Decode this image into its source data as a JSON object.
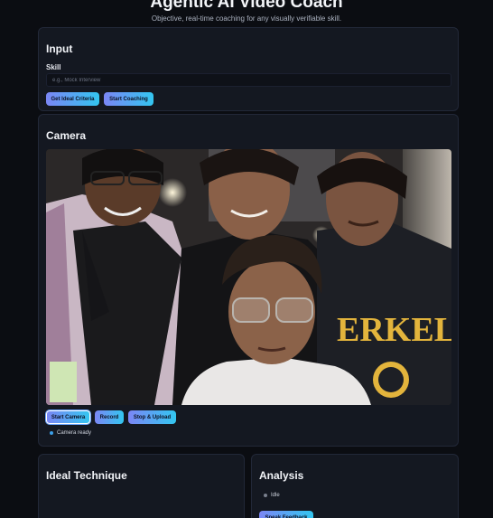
{
  "header": {
    "title": "Agentic AI Video Coach",
    "subtitle": "Objective, real-time coaching for any visually verifiable skill."
  },
  "input": {
    "heading": "Input",
    "skill_label": "Skill",
    "skill_placeholder": "e.g., Mock Interview",
    "skill_value": "",
    "get_criteria_label": "Get Ideal Criteria",
    "start_coaching_label": "Start Coaching"
  },
  "camera": {
    "heading": "Camera",
    "start_camera_label": "Start Camera",
    "record_label": "Record",
    "stop_upload_label": "Stop & Upload",
    "status_text": "Camera ready",
    "status_color": "#3b9fe8"
  },
  "technique": {
    "heading": "Ideal Technique"
  },
  "analysis": {
    "heading": "Analysis",
    "status_text": "Idle",
    "status_color": "#7a808e",
    "speak_feedback_label": "Speak Feedback"
  },
  "colors": {
    "background": "#0b0d12",
    "panel": "#141821",
    "accent_start": "#7b86f5",
    "accent_end": "#33c6f0"
  }
}
